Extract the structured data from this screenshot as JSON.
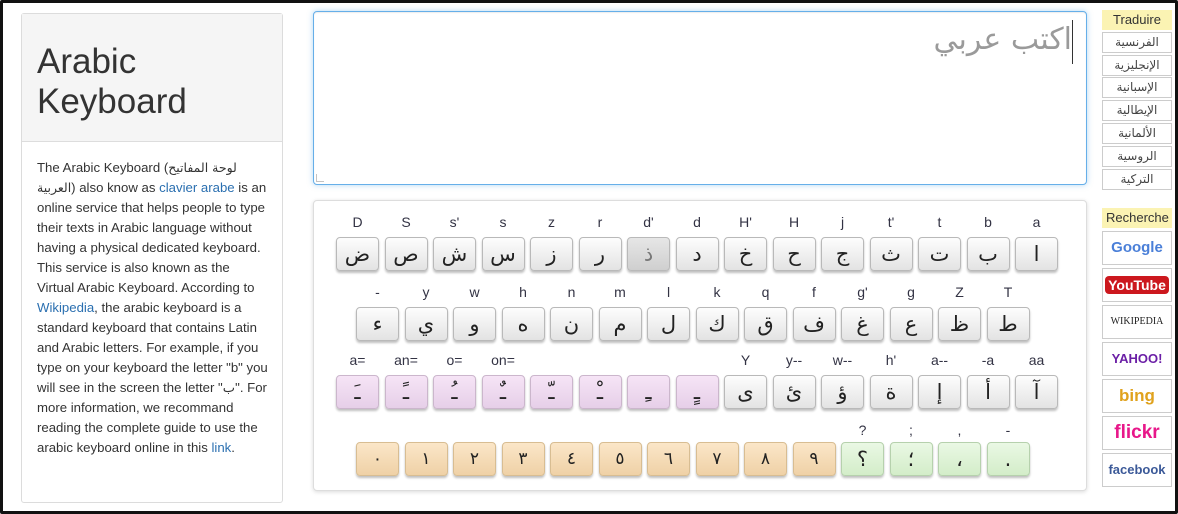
{
  "sidebar": {
    "title_line1": "Arabic",
    "title_line2": "Keyboard",
    "p1": "The Arabic Keyboard (",
    "arabic_name": "لوحة المفاتيح العربية",
    "p2": ") also know as ",
    "link1": "clavier arabe",
    "p3": " is an online service that helps people to type their texts in Arabic language without having a physical dedicated keyboard. This service is also known as the Virtual Arabic Keyboard. According to ",
    "link2": "Wikipedia",
    "p4": ", the arabic keyboard is a standard keyboard that contains Latin and Arabic letters. For example, if you type on your keyboard the letter \"b\" you will see in the screen the letter \"ب\". For more information, we recommand reading the complete guide to use the arabic keyboard online in this ",
    "link3": "link",
    "p5": "."
  },
  "editor": {
    "text": "اكتب عربي"
  },
  "keyboard": {
    "row1": [
      {
        "lat": "D",
        "ar": "ض"
      },
      {
        "lat": "S",
        "ar": "ص"
      },
      {
        "lat": "s'",
        "ar": "ش"
      },
      {
        "lat": "s",
        "ar": "س"
      },
      {
        "lat": "z",
        "ar": "ز"
      },
      {
        "lat": "r",
        "ar": "ر"
      },
      {
        "lat": "d'",
        "ar": "ذ"
      },
      {
        "lat": "d",
        "ar": "د"
      },
      {
        "lat": "H'",
        "ar": "خ"
      },
      {
        "lat": "H",
        "ar": "ح"
      },
      {
        "lat": "j",
        "ar": "ج"
      },
      {
        "lat": "t'",
        "ar": "ث"
      },
      {
        "lat": "t",
        "ar": "ت"
      },
      {
        "lat": "b",
        "ar": "ب"
      },
      {
        "lat": "a",
        "ar": "ا"
      }
    ],
    "row2": [
      {
        "lat": "-",
        "ar": "ء"
      },
      {
        "lat": "y",
        "ar": "ي"
      },
      {
        "lat": "w",
        "ar": "و"
      },
      {
        "lat": "h",
        "ar": "ه"
      },
      {
        "lat": "n",
        "ar": "ن"
      },
      {
        "lat": "m",
        "ar": "م"
      },
      {
        "lat": "l",
        "ar": "ل"
      },
      {
        "lat": "k",
        "ar": "ك"
      },
      {
        "lat": "q",
        "ar": "ق"
      },
      {
        "lat": "f",
        "ar": "ف"
      },
      {
        "lat": "g'",
        "ar": "غ"
      },
      {
        "lat": "g",
        "ar": "ع"
      },
      {
        "lat": "Z",
        "ar": "ظ"
      },
      {
        "lat": "T",
        "ar": "ط"
      }
    ],
    "row3": [
      {
        "lat": "a=",
        "ar": "ـَ"
      },
      {
        "lat": "an=",
        "ar": "ـً"
      },
      {
        "lat": "o=",
        "ar": "ـُ"
      },
      {
        "lat": "on=",
        "ar": "ـٌ"
      },
      {
        "lat": "",
        "ar": "ـّ"
      },
      {
        "lat": "",
        "ar": "ـْ"
      },
      {
        "lat": "",
        "ar": "ـِ"
      },
      {
        "lat": "",
        "ar": "ـٍ"
      },
      {
        "lat": "Y",
        "ar": "ى"
      },
      {
        "lat": "y--",
        "ar": "ئ"
      },
      {
        "lat": "w--",
        "ar": "ؤ"
      },
      {
        "lat": "h'",
        "ar": "ة"
      },
      {
        "lat": "a--",
        "ar": "إ"
      },
      {
        "lat": "-a",
        "ar": "أ"
      },
      {
        "lat": "aa",
        "ar": "آ"
      }
    ],
    "row4": [
      {
        "lat": "",
        "ar": "٠"
      },
      {
        "lat": "",
        "ar": "١"
      },
      {
        "lat": "",
        "ar": "٢"
      },
      {
        "lat": "",
        "ar": "٣"
      },
      {
        "lat": "",
        "ar": "٤"
      },
      {
        "lat": "",
        "ar": "٥"
      },
      {
        "lat": "",
        "ar": "٦"
      },
      {
        "lat": "",
        "ar": "٧"
      },
      {
        "lat": "",
        "ar": "٨"
      },
      {
        "lat": "",
        "ar": "٩"
      },
      {
        "lat": "?",
        "ar": "؟"
      },
      {
        "lat": ";",
        "ar": "؛"
      },
      {
        "lat": ",",
        "ar": "،"
      },
      {
        "lat": "-",
        "ar": "."
      }
    ]
  },
  "translate": {
    "header": "Traduire",
    "items": [
      "الفرنسية",
      "الإنجليزية",
      "الإسبانية",
      "الإيطالية",
      "الألمانية",
      "الروسية",
      "التركية"
    ]
  },
  "search": {
    "header": "Recherche",
    "items": [
      {
        "name": "google",
        "label": "Google",
        "color": "#4a7fd8"
      },
      {
        "name": "youtube",
        "label": "YouTube",
        "color": "#cc181e"
      },
      {
        "name": "wikipedia",
        "label": "WIKIPEDIA",
        "color": "#222222"
      },
      {
        "name": "yahoo",
        "label": "YAHOO!",
        "color": "#6b1fa6"
      },
      {
        "name": "bing",
        "label": "bing",
        "color": "#e0a21d"
      },
      {
        "name": "flickr",
        "label": "flickr",
        "color": "#e8178a"
      },
      {
        "name": "facebook",
        "label": "facebook",
        "color": "#3b5998"
      }
    ]
  }
}
